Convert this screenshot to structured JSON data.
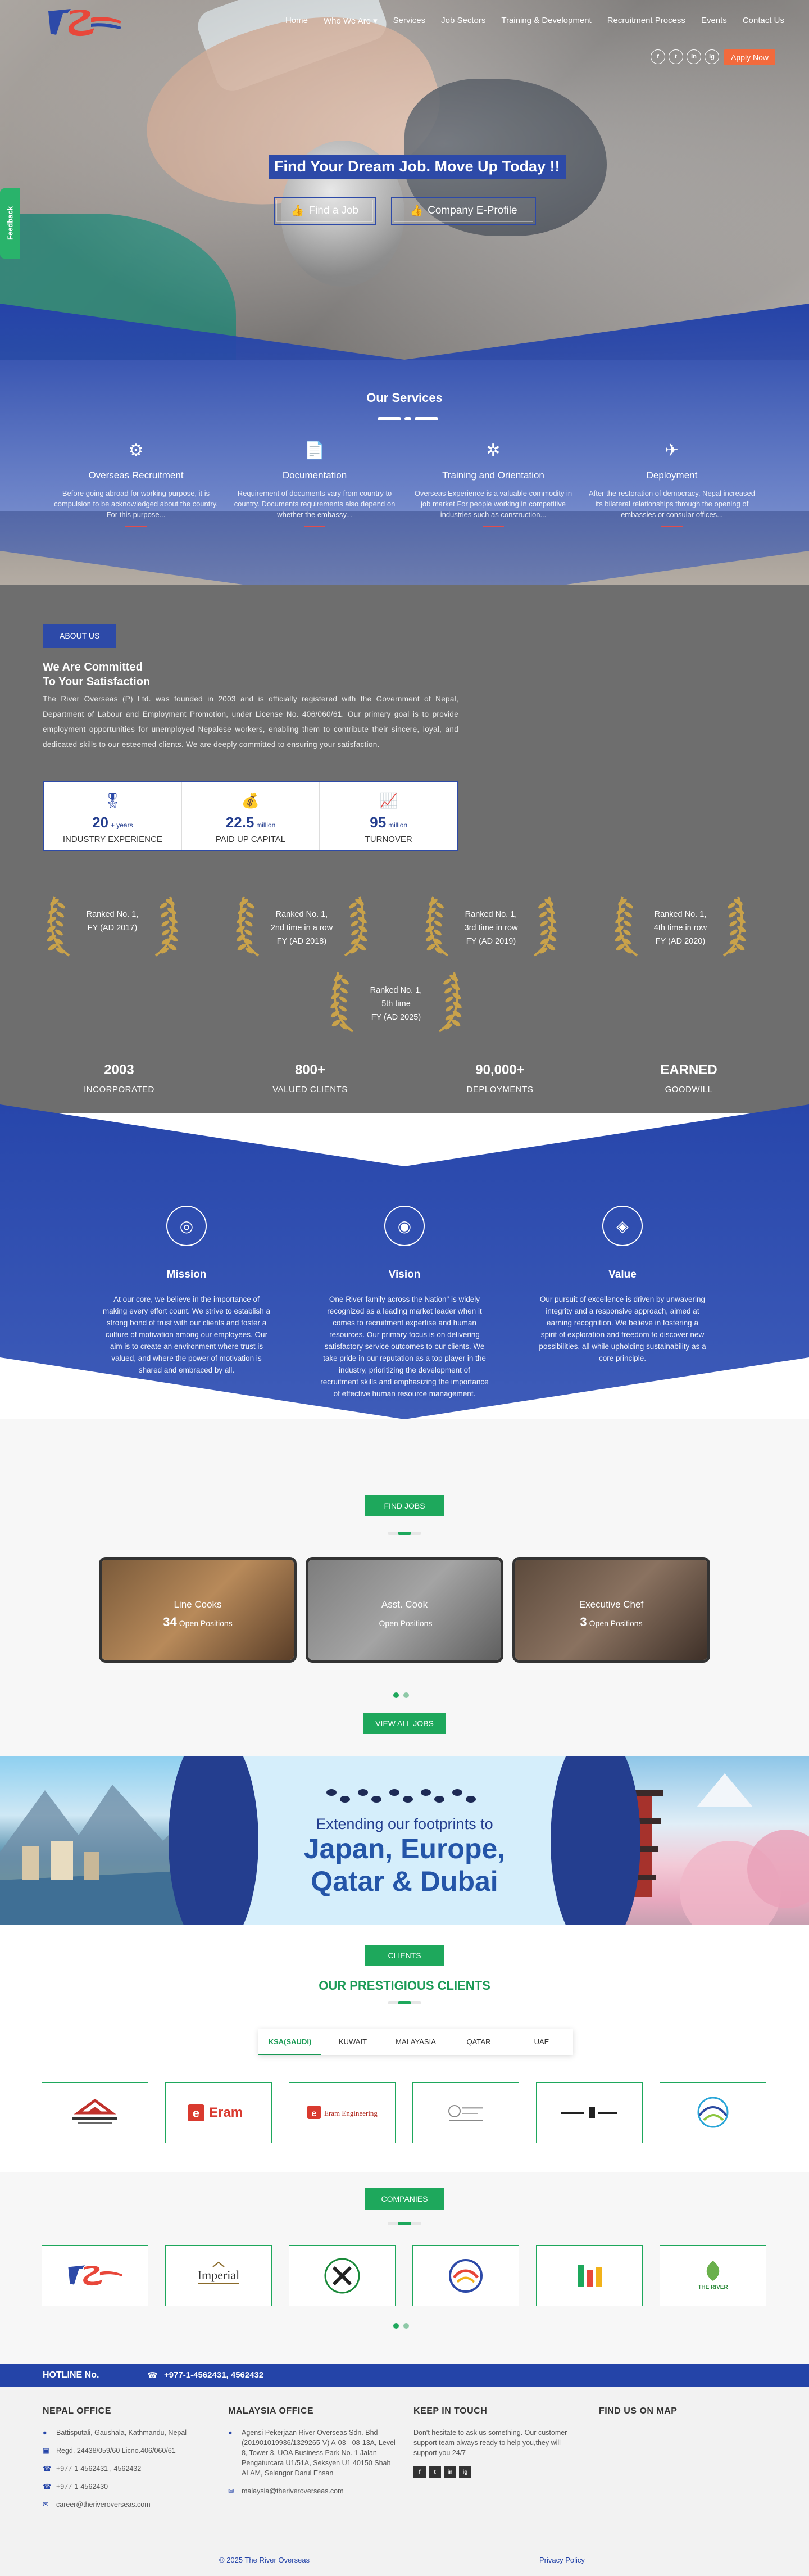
{
  "nav": {
    "items": [
      "Home",
      "Who We Are",
      "Services",
      "Job Sectors",
      "Training & Development",
      "Recruitment Process",
      "Events",
      "Contact Us"
    ],
    "social": [
      "f",
      "t",
      "in",
      "ig"
    ],
    "apply_label": "Apply Now"
  },
  "feedback_label": "Feedback",
  "hero": {
    "title": "Find Your Dream Job. Move Up Today !!",
    "find_job": "Find a Job",
    "eprofile": "Company E-Profile"
  },
  "services": {
    "title": "Our Services",
    "items": [
      {
        "icon": "recruitment-icon",
        "name": "Overseas Recruitment",
        "desc": "Before going abroad for working purpose, it is compulsion to be acknowledged about the country. For this purpose..."
      },
      {
        "icon": "documentation-icon",
        "name": "Documentation",
        "desc": "Requirement of documents vary from country to country. Documents requirements also depend on whether the embassy..."
      },
      {
        "icon": "training-icon",
        "name": "Training and Orientation",
        "desc": "Overseas Experience is a valuable commodity in job market For people working in competitive industries such as construction..."
      },
      {
        "icon": "deployment-icon",
        "name": "Deployment",
        "desc": "After the restoration of democracy, Nepal increased its bilateral relationships through the opening of embassies or consular offices..."
      }
    ]
  },
  "about": {
    "button": "ABOUT US",
    "heading_1": "We Are Committed",
    "heading_2": "To Your Satisfaction",
    "paragraph": "The River Overseas (P) Ltd. was founded in 2003 and is officially registered with the Government of Nepal, Department of Labour and Employment Promotion, under License No. 406/060/61. Our primary goal is to provide employment opportunities for unemployed Nepalese workers, enabling them to contribute their sincere, loyal, and dedicated skills to our esteemed clients. We are deeply committed to ensuring your satisfaction.",
    "stats": [
      {
        "num": "20",
        "unit": "+ years",
        "label": "INDUSTRY EXPERIENCE"
      },
      {
        "num": "22.5",
        "unit": "million",
        "label": "PAID UP CAPITAL"
      },
      {
        "num": "95",
        "unit": "million",
        "label": "TURNOVER"
      }
    ]
  },
  "awards": [
    {
      "l1": "Ranked No. 1,",
      "l2": "FY (AD 2017)",
      "l3": ""
    },
    {
      "l1": "Ranked No. 1,",
      "l2": "2nd time in a row",
      "l3": "FY (AD 2018)"
    },
    {
      "l1": "Ranked No. 1,",
      "l2": "3rd time in row",
      "l3": "FY (AD 2019)"
    },
    {
      "l1": "Ranked No. 1,",
      "l2": "4th time in row",
      "l3": "FY (AD 2020)"
    },
    {
      "l1": "Ranked No. 1,",
      "l2": "5th time",
      "l3": "FY (AD 2025)"
    }
  ],
  "counters": [
    {
      "num": "2003",
      "label": "INCORPORATED"
    },
    {
      "num": "800+",
      "label": "VALUED CLIENTS"
    },
    {
      "num": "90,000+",
      "label": "DEPLOYMENTS"
    },
    {
      "num": "EARNED",
      "label": "GOODWILL"
    }
  ],
  "mvv": [
    {
      "name": "Mission",
      "desc": "At our core, we believe in the importance of making every effort count. We strive to establish a strong bond of trust with our clients and foster a culture of motivation among our employees. Our aim is to create an environment where trust is valued, and where the power of motivation is shared and embraced by all."
    },
    {
      "name": "Vision",
      "desc": "One River family across the Nation\" is widely recognized as a leading market leader when it comes to recruitment expertise and human resources. Our primary focus is on delivering satisfactory service outcomes to our clients. We take pride in our reputation as a top player in the industry, prioritizing the development of recruitment skills and emphasizing the importance of effective human resource management."
    },
    {
      "name": "Value",
      "desc": "Our pursuit of excellence is driven by unwavering integrity and a responsive approach, aimed at earning recognition. We believe in fostering a spirit of exploration and freedom to discover new possibilities, all while upholding sustainability as a core principle."
    }
  ],
  "jobs": {
    "pill": "FIND JOBS",
    "cards": [
      {
        "title": "Line Cooks",
        "count": "34",
        "sub": "Open Positions"
      },
      {
        "title": "Asst. Cook",
        "count": "",
        "sub": "Open Positions"
      },
      {
        "title": "Executive Chef",
        "count": "3",
        "sub": "Open Positions"
      }
    ],
    "view_all": "VIEW ALL JOBS"
  },
  "banner": {
    "sub": "Extending our footprints to",
    "line1": "Japan, Europe,",
    "line2": "Qatar & Dubai"
  },
  "clients": {
    "pill": "CLIENTS",
    "heading": "OUR PRESTIGIOUS CLIENTS",
    "tabs": [
      "KSA(SAUDI)",
      "KUWAIT",
      "MALAYASIA",
      "QATAR",
      "UAE"
    ],
    "logos": [
      "Al Maktab Construction",
      "Eram",
      "Eram Engineering",
      "Client Logo",
      "Client Logo",
      "Taslash"
    ]
  },
  "companies": {
    "pill": "COMPANIES",
    "logos": [
      "JS",
      "Imperial",
      "Company Logo",
      "Company Logo",
      "Company Logo",
      "THE RIVER"
    ]
  },
  "hotline": {
    "label": "HOTLINE No.",
    "number": "+977-1-4562431, 4562432"
  },
  "footer": {
    "nepal": {
      "title": "NEPAL OFFICE",
      "address": "Battisputali, Gaushala, Kathmandu, Nepal",
      "regd": "Regd. 24438/059/60 Licno.406/060/61",
      "phone1": "+977-1-4562431 , 4562432",
      "phone2": "+977-1-4562430",
      "email": "career@theriveroverseas.com"
    },
    "malaysia": {
      "title": "MALAYSIA OFFICE",
      "address": "Agensi Pekerjaan River Overseas Sdn. Bhd (201901019936/1329265-V) A-03 - 08-13A, Level 8, Tower 3, UOA Business Park No. 1 Jalan Pengaturcara U1/51A, Seksyen U1 40150 Shah ALAM, Selangor Darul Ehsan",
      "email": "malaysia@theriveroverseas.com"
    },
    "touch": {
      "title": "KEEP IN TOUCH",
      "text": "Don't hesitate to ask us something. Our customer support team always ready to help you,they will support you 24/7"
    },
    "map": {
      "title": "FIND US ON MAP"
    },
    "copyright": "© 2025 The River Overseas",
    "privacy": "Privacy Policy"
  },
  "colors": {
    "blue": "#2d4aa8",
    "green": "#1ea85c",
    "orange": "#f26a3d"
  }
}
